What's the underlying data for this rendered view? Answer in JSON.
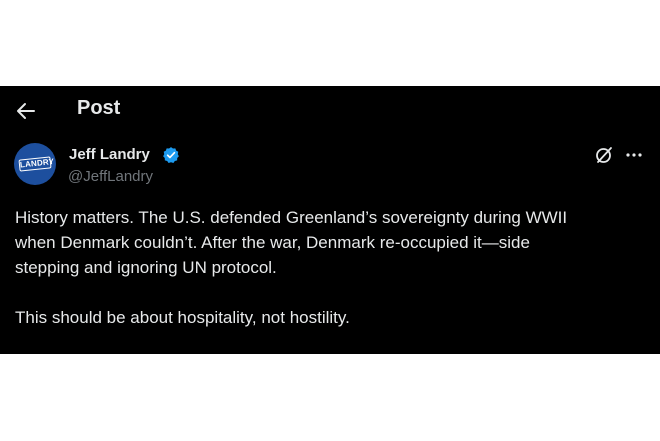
{
  "header": {
    "back_icon": "arrow-left-icon",
    "title": "Post"
  },
  "author": {
    "avatar_text": "LANDRY",
    "avatar_color": "#1d4f9e",
    "display_name": "Jeff Landry",
    "verified_icon": "verified-badge-icon",
    "verified_color": "#1d9bf0",
    "handle": "@JeffLandry"
  },
  "actions": {
    "grok_icon": "grok-icon",
    "more_icon": "more-horizontal-icon"
  },
  "post": {
    "paragraph_1": "History matters. The U.S. defended Greenland’s sovereignty during WWII\nwhen Denmark couldn’t. After the war, Denmark re-occupied it—side\nstepping and ignoring UN protocol.",
    "paragraph_2": "This should be about hospitality, not hostility."
  },
  "colors": {
    "background": "#000000",
    "text_primary": "#e7e9ea",
    "text_secondary": "#71767b",
    "page_background": "#ffffff"
  }
}
